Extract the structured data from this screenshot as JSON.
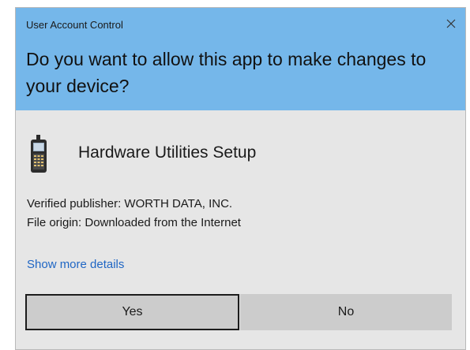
{
  "dialog": {
    "title": "User Account Control",
    "question": "Do you want to allow this app to make changes to your device?",
    "close_icon": "close-icon",
    "header_color": "#75b7ea",
    "body_color": "#e6e6e6"
  },
  "app": {
    "icon": "handheld-terminal-icon",
    "name": "Hardware Utilities Setup",
    "publisher": "Verified publisher: WORTH DATA, INC.",
    "origin": "File origin: Downloaded from the Internet"
  },
  "links": {
    "more_details": "Show more details",
    "link_color": "#1f66c4"
  },
  "buttons": {
    "yes": "Yes",
    "no": "No"
  }
}
